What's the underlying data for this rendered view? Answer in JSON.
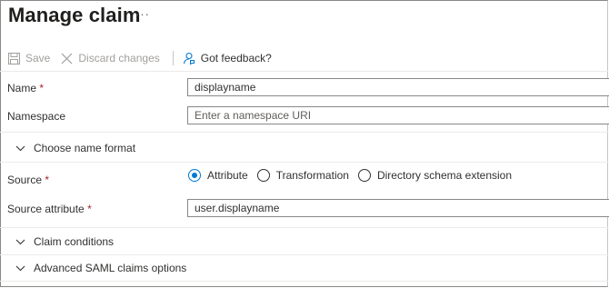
{
  "header": {
    "title": "Manage claim",
    "more": "···"
  },
  "toolbar": {
    "save": "Save",
    "discard": "Discard changes",
    "feedback": "Got feedback?"
  },
  "fields": {
    "name": {
      "label": "Name",
      "required": "*",
      "value": "displayname"
    },
    "namespace": {
      "label": "Namespace",
      "placeholder": "Enter a namespace URI",
      "value": ""
    },
    "source": {
      "label": "Source",
      "required": "*",
      "options": [
        "Attribute",
        "Transformation",
        "Directory schema extension"
      ],
      "selected": "Attribute"
    },
    "source_attribute": {
      "label": "Source attribute",
      "required": "*",
      "value": "user.displayname"
    }
  },
  "sections": {
    "name_format": "Choose name format",
    "claim_conditions": "Claim conditions",
    "advanced_saml": "Advanced SAML claims options"
  },
  "colors": {
    "accent": "#0078d4",
    "required": "#a4262c",
    "disabled": "#a19f9d"
  },
  "icons": {
    "save": "save-icon",
    "discard": "close-icon",
    "feedback": "feedback-icon",
    "expand": "chevron-down-icon"
  }
}
